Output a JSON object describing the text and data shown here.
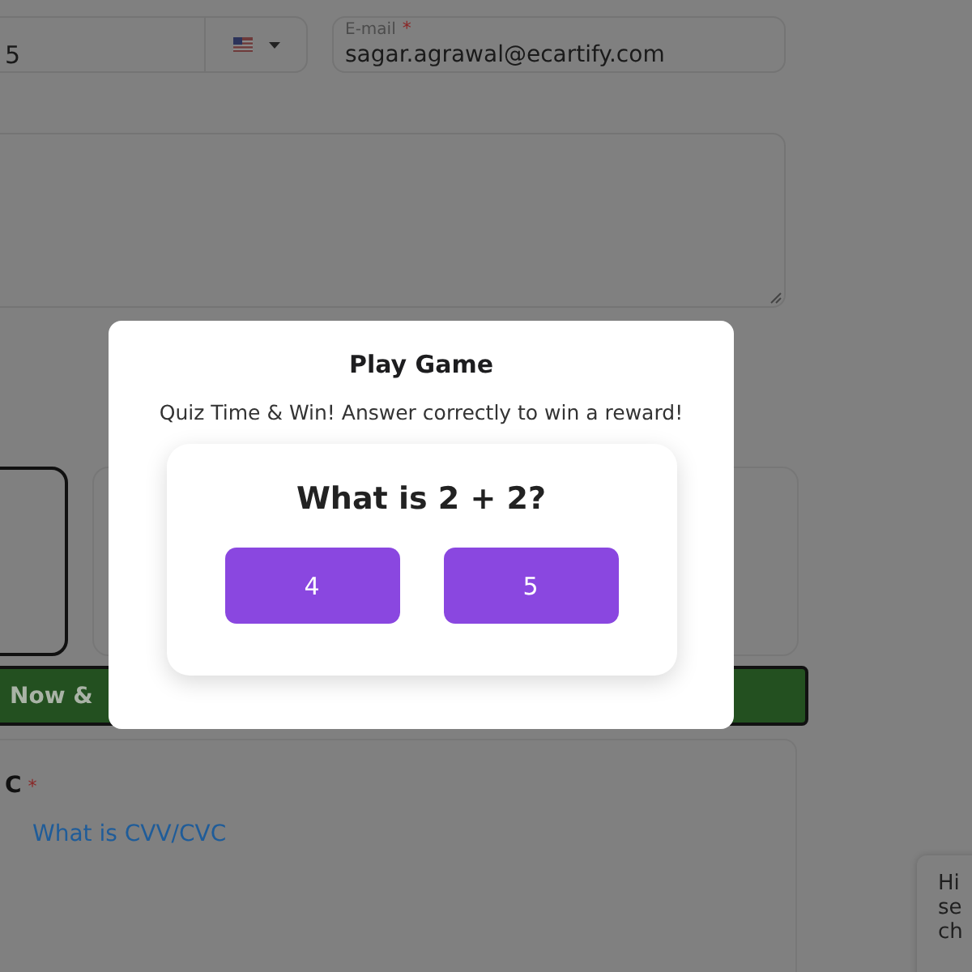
{
  "form": {
    "phone": {
      "value": "5"
    },
    "email": {
      "label": "E-mail",
      "required_mark": "*",
      "value": "sagar.agrawal@ecartify.com"
    },
    "options": [
      {
        "selected": true
      },
      {
        "selected": false
      }
    ],
    "submit_button": {
      "label": "Now &"
    },
    "cvv": {
      "label": "C",
      "required_mark": "*",
      "link": "What is CVV/CVC"
    }
  },
  "chat_bubble": {
    "lines": [
      "Hi",
      "se",
      "ch"
    ]
  },
  "modal": {
    "title": "Play Game",
    "subtitle": "Quiz Time & Win! Answer correctly to win a reward!",
    "question": "What is 2 + 2?",
    "answers": [
      "4",
      "5"
    ]
  }
}
